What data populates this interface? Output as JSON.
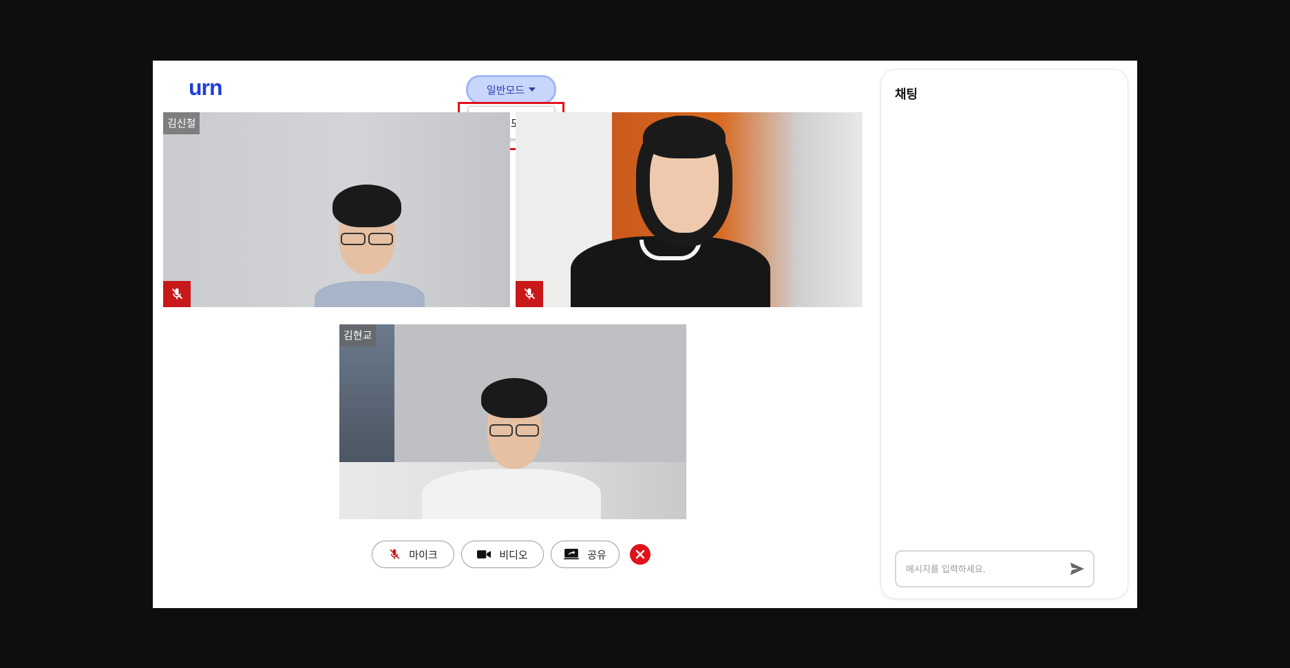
{
  "logo": {
    "text": "urn"
  },
  "mode": {
    "current": "일반모드",
    "options": [
      "면접모드"
    ]
  },
  "participants": [
    {
      "name": "김신철",
      "muted": true
    },
    {
      "name": "",
      "muted": true
    },
    {
      "name": "김현교",
      "muted": false
    }
  ],
  "controls": {
    "mic_label": "마이크",
    "video_label": "비디오",
    "share_label": "공유"
  },
  "chat": {
    "title": "채팅",
    "placeholder": "메시지를 입력하세요."
  },
  "colors": {
    "accent": "#1f3fd9",
    "mode_bg": "#c9d6fb",
    "highlight": "#e0121b",
    "mute_bg": "#c8181a"
  }
}
